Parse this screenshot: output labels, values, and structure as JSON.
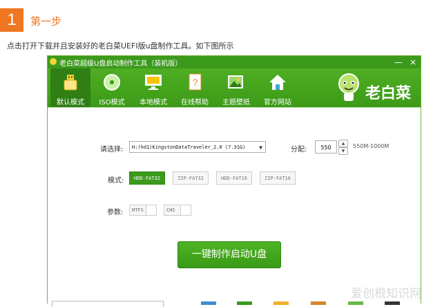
{
  "step": {
    "number": "1",
    "title": "第一步"
  },
  "intro": "点击打开下载并且安装好的老白菜UEFI版u盘制作工具。如下图所示",
  "window": {
    "title": "老白菜超级U盘启动制作工具（装机版）",
    "minimize": "—",
    "close": "×",
    "tabs": [
      {
        "label": "默认模式",
        "icon": "usb-drive-icon"
      },
      {
        "label": "ISO模式",
        "icon": "disc-icon"
      },
      {
        "label": "本地模式",
        "icon": "monitor-icon"
      },
      {
        "label": "在线帮助",
        "icon": "help-book-icon"
      },
      {
        "label": "主题壁纸",
        "icon": "wallpaper-icon"
      },
      {
        "label": "官方网站",
        "icon": "home-icon"
      }
    ],
    "logo_text": "老白菜"
  },
  "form": {
    "select_label": "请选择:",
    "drive_value": "H:(hd1)KingstonDataTraveler_2.0 (7.31G)",
    "partition_label": "分配:",
    "partition_value": "550",
    "partition_range": "550M-1000M",
    "mode_label": "模式:",
    "modes": [
      "HDD-FAT32",
      "ZIP-FAT32",
      "HDD-FAT16",
      "ZIP-FAT16"
    ],
    "param_label": "参数:",
    "params": [
      "NTFS",
      "CHS"
    ],
    "make_button": "一键制作启动U盘"
  },
  "colors": {
    "accent": "#3b9a1c",
    "step": "#f07722"
  },
  "watermark": "爱创根知识网"
}
